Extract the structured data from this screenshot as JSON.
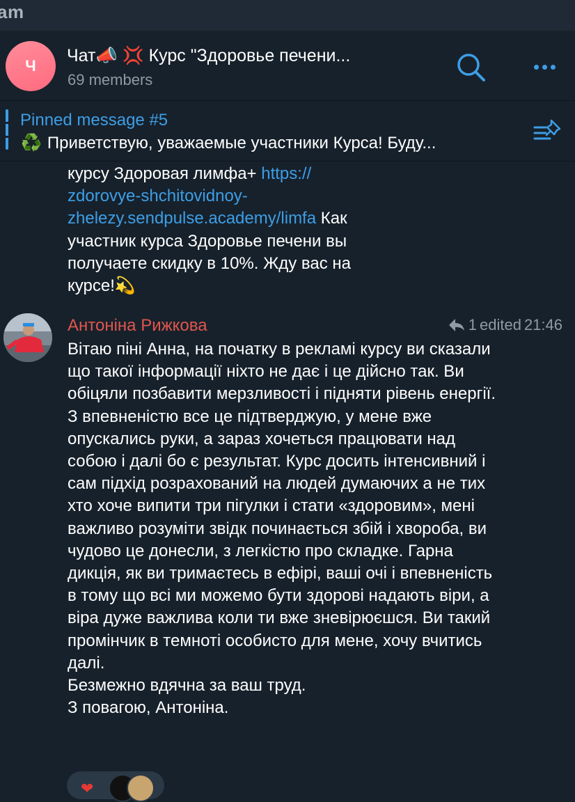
{
  "topbar": {
    "app_title": "am"
  },
  "header": {
    "avatar_letter": "Ч",
    "title": "Чат📣 💢 Курс \"Здоровье печени...",
    "subtitle": "69 members"
  },
  "pinned": {
    "title": "Pinned message #5",
    "text": "Приветствую, уважаемые участники Курса!   Буду...",
    "emoji": "♻️"
  },
  "messages": [
    {
      "text_before_link": "курсу Здоровая лимфа+ ",
      "link": "https://zdorovye-shchitovidnoy-zhelezy.sendpulse.academy/limfa",
      "link_line1": "https://",
      "link_line2": "zdorovye-shchitovidnoy-",
      "link_line3": "zhelezy.sendpulse.academy/limfa",
      "text_after_link": " Как участник курса Здоровье печени вы получаете скидку в 10%. Жду вас на курсе!💫"
    },
    {
      "sender": "Антоніна Рижкова",
      "reply_count": "1",
      "edited": "edited",
      "time": "21:46",
      "text": "Вітаю піні Анна, на початку в рекламі курсу ви сказали що такої інформації ніхто не дає і це дійсно так. Ви обіцяли позбавити мерзливості і підняти рівень енергії. З впевненістю все це підтверджую, у мене вже опускались руки, а зараз хочеться працювати над собою і далі бо є результат. Курс досить інтенсивний і сам підхід розрахований на людей думаючих а не тих хто хоче випити три пігулки і стати «здоровим», мені важливо розуміти звідк починається збій і хвороба, ви чудово це донесли, з легкістю про складке. Гарна дикція, як ви тримаєтесь в ефірі, ваші очі і впевненість в тому що всі ми можемо бути здорові надають віри, а віра дуже важлива коли ти вже зневірюєшся. Ви такий промінчик в темноті особисто для мене, хочу вчитись далі.",
      "text_line2": "Безмежно вдячна за ваш труд.",
      "text_line3": "З повагою, Антоніна.",
      "reaction": "❤"
    }
  ],
  "colors": {
    "accent": "#3d9ee6",
    "sender_name": "#e0564e",
    "background": "#17212b"
  }
}
